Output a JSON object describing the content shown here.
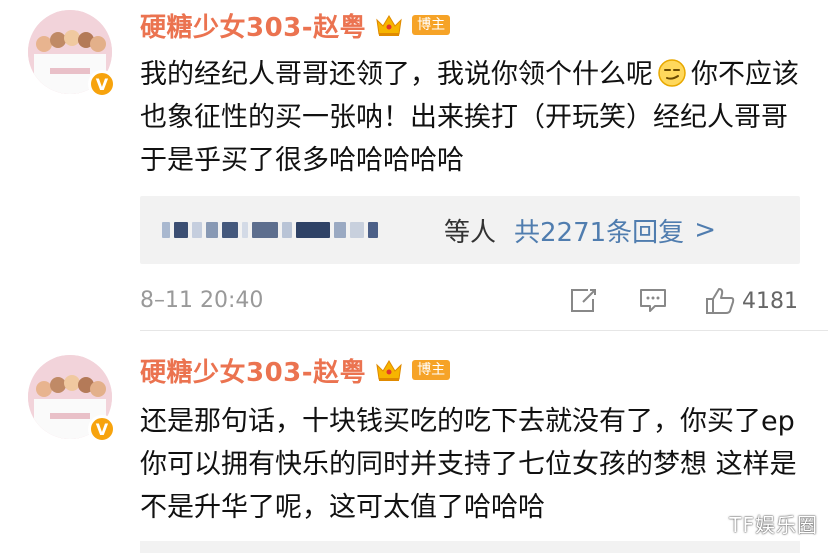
{
  "colors": {
    "username": "#eb7350",
    "host_badge": "#f6a327",
    "verified": "#f7a30d",
    "reply_link": "#507daf",
    "meta_text": "#999999",
    "reply_bg": "#f2f2f2"
  },
  "comments": [
    {
      "username": "硬糖少女303-赵粤",
      "badge": "博主",
      "verified_mark": "V",
      "crown_icon": "crown-icon",
      "body_before_emoji": "我的经纪人哥哥还领了，我说你领个什么呢",
      "emoji_icon": "smirk-emoji-icon",
      "body_after_emoji": "你不应该也象征性的买一张呐！出来挨打（开玩笑）经纪人哥哥于是乎买了很多哈哈哈哈哈",
      "replies": {
        "label": "等人",
        "count_text": "共2271条回复",
        "chevron": ">"
      },
      "timestamp": "8–11 20:40",
      "likes": "4181"
    },
    {
      "username": "硬糖少女303-赵粤",
      "badge": "博主",
      "verified_mark": "V",
      "crown_icon": "crown-icon",
      "body": "还是那句话，十块钱买吃的吃下去就没有了，你买了ep你可以拥有快乐的同时并支持了七位女孩的梦想 这样是不是升华了呢，这可太值了哈哈哈"
    }
  ],
  "watermark": "TF娱乐圈"
}
